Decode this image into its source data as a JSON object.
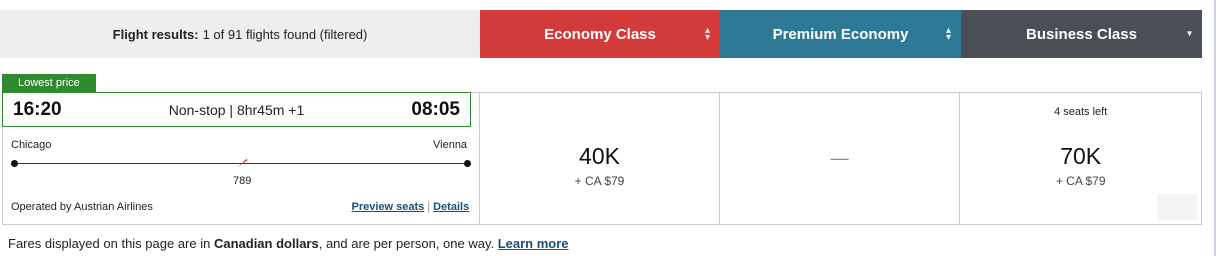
{
  "header": {
    "results_label": "Flight results:",
    "results_text": "1 of 91 flights found (filtered)",
    "tabs": [
      {
        "label": "Economy Class",
        "color": "#d33a3a"
      },
      {
        "label": "Premium Economy",
        "color": "#2e7a96"
      },
      {
        "label": "Business Class",
        "color": "#4a4e55"
      }
    ]
  },
  "badge": {
    "label": "Lowest price",
    "color": "#2f8a2f"
  },
  "flight": {
    "depart_time": "16:20",
    "summary": "Non-stop | 8hr45m +1",
    "arrive_time": "08:05",
    "origin": "Chicago",
    "destination": "Vienna",
    "aircraft": "789",
    "operated_by": "Operated by Austrian Airlines",
    "preview_seats": "Preview seats",
    "link_separator": "|",
    "details": "Details"
  },
  "fares": {
    "economy": {
      "miles": "40K",
      "tax": "+ CA $79"
    },
    "premium": {
      "empty": "—"
    },
    "business": {
      "seats_left": "4 seats left",
      "miles": "70K",
      "tax": "+ CA $79"
    }
  },
  "footer": {
    "part1": "Fares displayed on this page are in ",
    "currency": "Canadian dollars",
    "part2": ", and are per person, one way. ",
    "learn_more": "Learn more"
  }
}
